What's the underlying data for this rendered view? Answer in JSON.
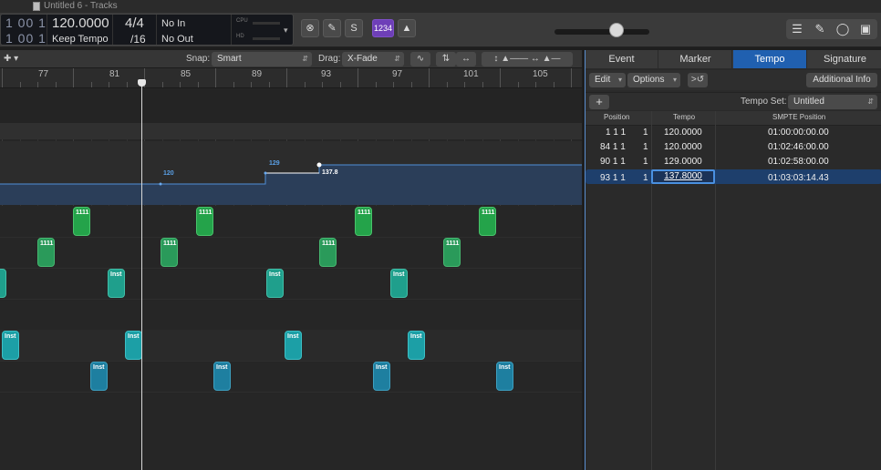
{
  "window": {
    "title": "Untitled 6 - Tracks"
  },
  "lcd": {
    "bars_top": "1  00 1",
    "bars_bottom": "1  00 1",
    "tempo": "120.0000",
    "tempo_mode": "Keep Tempo",
    "signature": "4/4",
    "division": "/16",
    "midi_in": "No In",
    "midi_out": "No Out",
    "cpu_label": "CPU",
    "hd_label": "HD"
  },
  "controlbar": {
    "count_in_label": "1234"
  },
  "arrange_toolbar": {
    "snap_label": "Snap:",
    "snap_value": "Smart",
    "drag_label": "Drag:",
    "drag_value": "X-Fade"
  },
  "ruler": {
    "bars": [
      "77",
      "81",
      "85",
      "89",
      "93",
      "97",
      "101",
      "105"
    ]
  },
  "tempo_track": {
    "points": [
      {
        "label": "120"
      },
      {
        "label": "129"
      },
      {
        "label": "137.8"
      }
    ]
  },
  "regions": {
    "green_label": "1111",
    "inst_label": "Inst"
  },
  "list_editor": {
    "tabs": [
      "Event",
      "Marker",
      "Tempo",
      "Signature"
    ],
    "active_tab": "Tempo",
    "edit_menu": "Edit",
    "options_menu": "Options",
    "additional_info": "Additional Info",
    "add_button": "+",
    "tempo_set_label": "Tempo Set:",
    "tempo_set_value": "Untitled",
    "columns": [
      "Position",
      "Tempo",
      "SMPTE Position"
    ],
    "rows": [
      {
        "pos": "1  1  1",
        "sub": "1",
        "tempo": "120.0000",
        "smpte": "01:00:00:00.00"
      },
      {
        "pos": "84  1  1",
        "sub": "1",
        "tempo": "120.0000",
        "smpte": "01:02:46:00.00"
      },
      {
        "pos": "90  1  1",
        "sub": "1",
        "tempo": "129.0000",
        "smpte": "01:02:58:00.00"
      },
      {
        "pos": "93  1  1",
        "sub": "1",
        "tempo": "137.8000",
        "smpte": "01:03:03:14.43"
      }
    ]
  }
}
